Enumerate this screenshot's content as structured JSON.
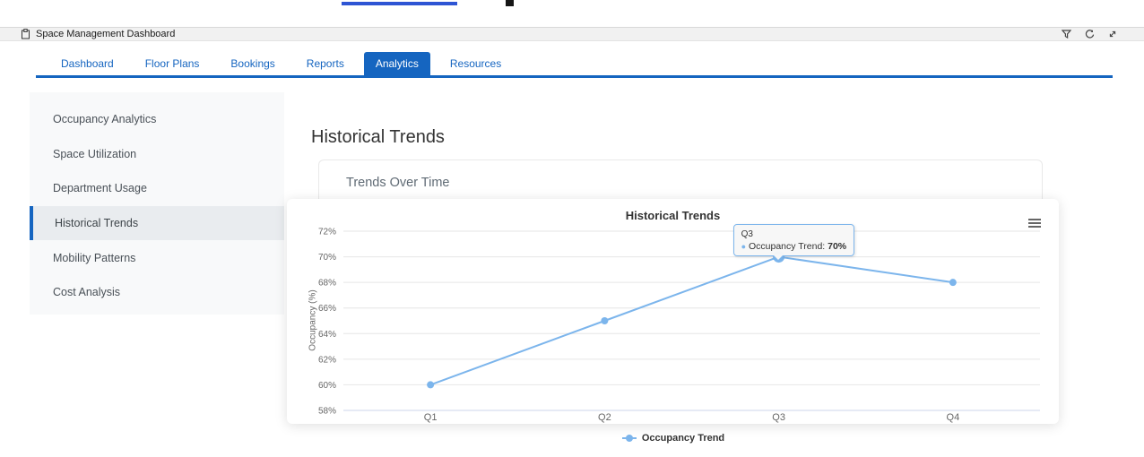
{
  "window": {
    "title": "Space Management Dashboard",
    "icon": "clipboard-icon",
    "toolbar_icons": [
      "filter-icon",
      "refresh-icon",
      "collapse-icon"
    ]
  },
  "tabs": [
    {
      "label": "Dashboard",
      "active": false
    },
    {
      "label": "Floor Plans",
      "active": false
    },
    {
      "label": "Bookings",
      "active": false
    },
    {
      "label": "Reports",
      "active": false
    },
    {
      "label": "Analytics",
      "active": true
    },
    {
      "label": "Resources",
      "active": false
    }
  ],
  "sidebar": {
    "items": [
      {
        "label": "Occupancy Analytics",
        "active": false
      },
      {
        "label": "Space Utilization",
        "active": false
      },
      {
        "label": "Department Usage",
        "active": false
      },
      {
        "label": "Historical Trends",
        "active": true
      },
      {
        "label": "Mobility Patterns",
        "active": false
      },
      {
        "label": "Cost Analysis",
        "active": false
      }
    ]
  },
  "main": {
    "page_title": "Historical Trends",
    "card_title": "Trends Over Time"
  },
  "chart_data": {
    "type": "line",
    "title": "Historical Trends",
    "categories": [
      "Q1",
      "Q2",
      "Q3",
      "Q4"
    ],
    "series": [
      {
        "name": "Occupancy Trend",
        "values": [
          60,
          65,
          70,
          68
        ],
        "color": "#7cb5ec"
      }
    ],
    "xlabel": "",
    "ylabel": "Occupancy (%)",
    "ylim": [
      58,
      72
    ],
    "ytick_interval": 2,
    "ytick_suffix": "%",
    "grid": true,
    "legend_position": "bottom",
    "context_menu_icon": "hamburger-icon",
    "tooltip": {
      "point_index": 2,
      "header": "Q3",
      "label": "Occupancy Trend:",
      "value": "70%"
    }
  },
  "colors": {
    "accent_blue": "#1565c0",
    "series_blue": "#7cb5ec",
    "gridline": "#e6e6e6",
    "axis_line": "#ccd6eb",
    "axis_label": "#666666",
    "chart_text": "#333333"
  }
}
